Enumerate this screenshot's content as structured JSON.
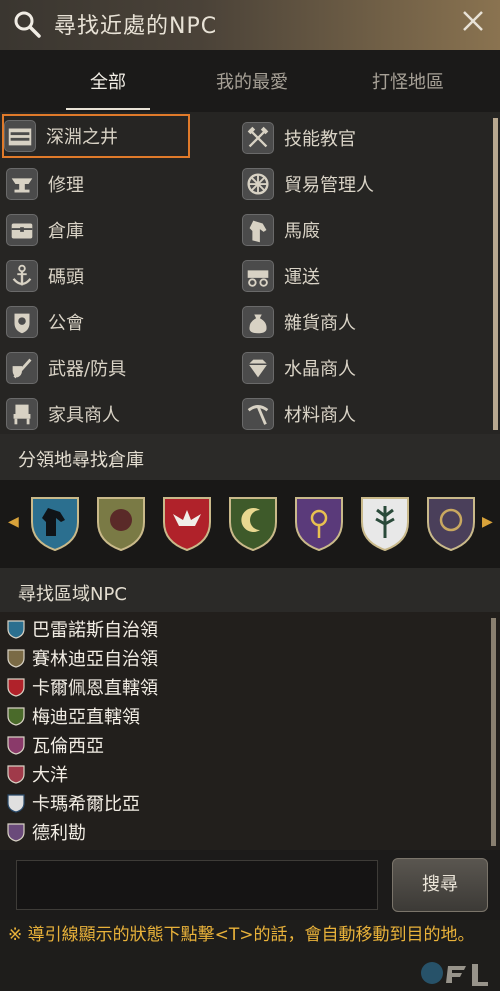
{
  "header": {
    "title": "尋找近處的NPC",
    "search_icon": "search-icon",
    "close_icon": "close-icon"
  },
  "tabs": [
    {
      "label": "全部",
      "active": true
    },
    {
      "label": "我的最愛",
      "active": false
    },
    {
      "label": "打怪地區",
      "active": false
    }
  ],
  "npc_types": {
    "left": [
      {
        "label": "深淵之井",
        "icon": "well-icon",
        "selected": true
      },
      {
        "label": "修理",
        "icon": "anvil-icon"
      },
      {
        "label": "倉庫",
        "icon": "chest-icon"
      },
      {
        "label": "碼頭",
        "icon": "anchor-icon"
      },
      {
        "label": "公會",
        "icon": "guild-crest-icon"
      },
      {
        "label": "武器/防具",
        "icon": "weapon-icon"
      },
      {
        "label": "家具商人",
        "icon": "chair-icon"
      }
    ],
    "right": [
      {
        "label": "技能教官",
        "icon": "crossed-axes-icon"
      },
      {
        "label": "貿易管理人",
        "icon": "wheel-icon"
      },
      {
        "label": "馬廄",
        "icon": "horse-icon"
      },
      {
        "label": "運送",
        "icon": "wagon-icon"
      },
      {
        "label": "雜貨商人",
        "icon": "sack-icon"
      },
      {
        "label": "水晶商人",
        "icon": "gem-icon"
      },
      {
        "label": "材料商人",
        "icon": "pickaxe-icon"
      }
    ]
  },
  "warehouse_section": {
    "title": "分領地尋找倉庫"
  },
  "crests": [
    {
      "name": "calpheon-horse-crest-icon",
      "color": "#2b6f8f"
    },
    {
      "name": "serendia-lion-crest-icon",
      "color": "#7a7a45"
    },
    {
      "name": "balenos-eagle-crest-icon",
      "color": "#b0222a"
    },
    {
      "name": "mediah-moon-crest-icon",
      "color": "#3e5a2a"
    },
    {
      "name": "valencia-eye-crest-icon",
      "color": "#5a3a7a"
    },
    {
      "name": "kamasylvia-tree-crest-icon",
      "color": "#e8e8e8"
    },
    {
      "name": "drieghan-crest-icon",
      "color": "#4a3f5a"
    }
  ],
  "region_section": {
    "title": "尋找區域NPC"
  },
  "regions": [
    {
      "label": "巴雷諾斯自治領",
      "color": "#2b6f8f"
    },
    {
      "label": "賽林迪亞自治領",
      "color": "#7a6a45"
    },
    {
      "label": "卡爾佩恩直轄領",
      "color": "#b0222a"
    },
    {
      "label": "梅迪亞直轄領",
      "color": "#4a6a2a"
    },
    {
      "label": "瓦倫西亞",
      "color": "#8a3a6a"
    },
    {
      "label": "大洋",
      "color": "#a03a4a"
    },
    {
      "label": "卡瑪希爾比亞",
      "color": "#e0e0e0"
    },
    {
      "label": "德利勘",
      "color": "#6a4a7a"
    }
  ],
  "search": {
    "placeholder": "",
    "button_label": "搜尋"
  },
  "footer": {
    "note": "※ 導引線顯示的狀態下點擊<T>的話，會自動移動到目的地。"
  },
  "colors": {
    "accent": "#e07a2a",
    "note": "#e9b23a",
    "arrow": "#d8a23a"
  }
}
